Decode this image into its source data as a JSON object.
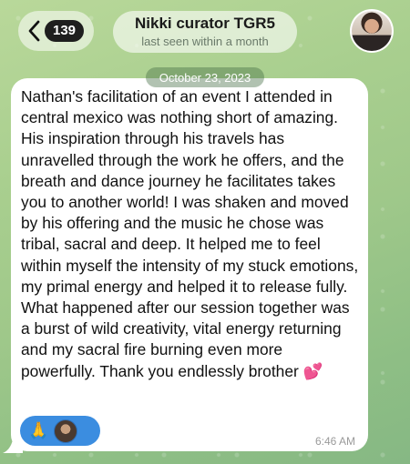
{
  "header": {
    "unread_count": "139",
    "contact_name": "Nikki curator TGR5",
    "status": "last seen within a month"
  },
  "date_separator": "October 23, 2023",
  "message": {
    "text": "Nathan's facilitation of an event I attended in central mexico was nothing short of amazing. His inspiration through his travels has unravelled through the work he offers, and the breath and dance journey he facilitates takes you to another world! I was shaken and moved by his offering and the music he chose was tribal, sacral and deep. It helped me to feel within myself the intensity of my stuck emotions, my primal energy and helped it to release fully. What happened after our session together was a burst of wild creativity, vital energy returning and my sacral fire burning even more powerfully. Thank you endlessly brother",
    "emoji": "💕",
    "time": "6:46 AM",
    "reaction_emoji": "🙏"
  },
  "colors": {
    "reaction_bg": "#3b8de0",
    "badge_bg": "#1e1e1e"
  }
}
